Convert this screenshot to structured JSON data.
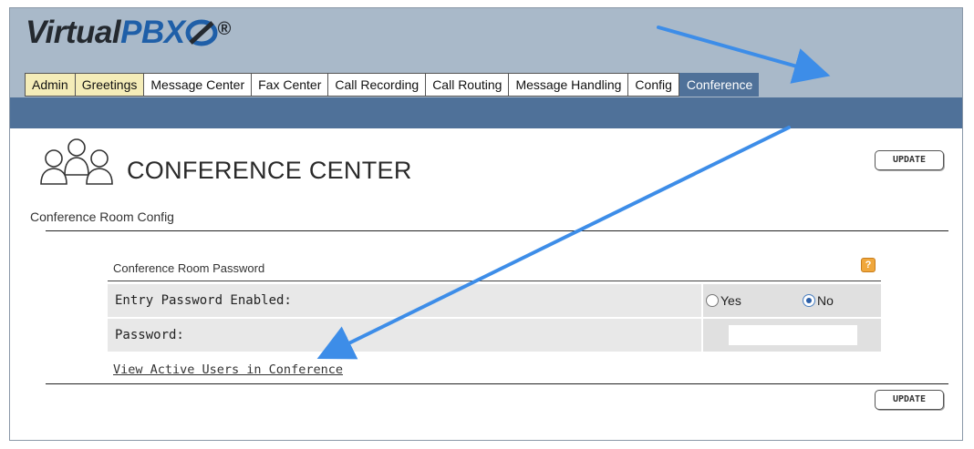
{
  "logo": {
    "prefix": "Virtual",
    "brand": "PBX",
    "reg": "®"
  },
  "tabs": [
    {
      "label": "Admin"
    },
    {
      "label": "Greetings"
    },
    {
      "label": "Message Center"
    },
    {
      "label": "Fax Center"
    },
    {
      "label": "Call Recording"
    },
    {
      "label": "Call Routing"
    },
    {
      "label": "Message Handling"
    },
    {
      "label": "Config"
    },
    {
      "label": "Conference",
      "active": true
    }
  ],
  "page": {
    "title": "CONFERENCE CENTER",
    "subtitle": "Conference Room Config",
    "update_label": "UPDATE"
  },
  "section": {
    "label": "Conference Room Password",
    "help": "?",
    "entry_password_label": "Entry Password Enabled:",
    "options": [
      {
        "label": "Yes",
        "checked": false
      },
      {
        "label": "No",
        "checked": true
      }
    ],
    "password_label": "Password:",
    "password_value": ""
  },
  "link_label": "View Active Users in Conference",
  "colors": {
    "tab_bar": "#4f7199",
    "frame": "#a9b9c9",
    "annotation_arrow": "#3d8de8",
    "help_icon": "#f0a73c"
  }
}
